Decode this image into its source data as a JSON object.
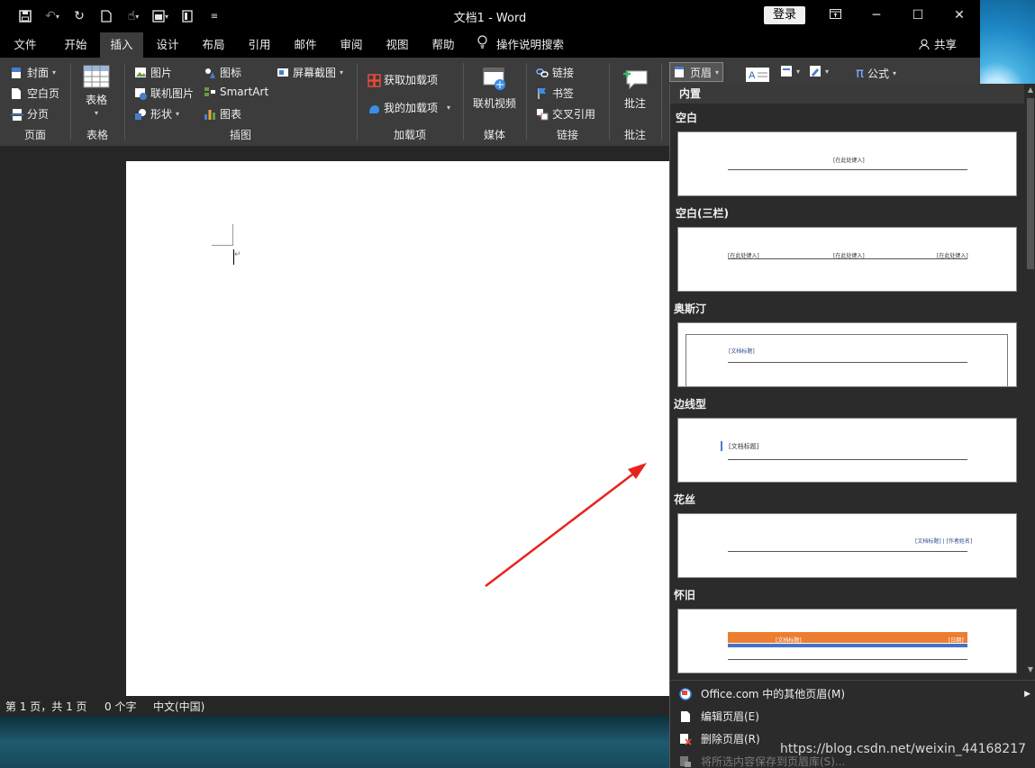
{
  "window": {
    "title": "文档1  -  Word",
    "login_label": "登录"
  },
  "menu": {
    "tabs": [
      "文件",
      "开始",
      "插入",
      "设计",
      "布局",
      "引用",
      "邮件",
      "审阅",
      "视图",
      "帮助"
    ],
    "active_tab": "插入",
    "tell_me": "操作说明搜索",
    "share": "共享"
  },
  "ribbon": {
    "pages": {
      "cover": "封面",
      "blank": "空白页",
      "break": "分页",
      "label": "页面"
    },
    "tables": {
      "table": "表格",
      "label": "表格"
    },
    "illustrations": {
      "pictures": "图片",
      "online_pictures": "联机图片",
      "shapes": "形状",
      "icons": "图标",
      "smartart": "SmartArt",
      "chart": "图表",
      "screenshot": "屏幕截图",
      "label": "插图"
    },
    "addins": {
      "get": "获取加载项",
      "mine": "我的加载项",
      "label": "加载项"
    },
    "media": {
      "video": "联机视频",
      "label": "媒体"
    },
    "links": {
      "link": "链接",
      "bookmark": "书签",
      "cross_ref": "交叉引用",
      "label": "链接"
    },
    "comments": {
      "comment": "批注",
      "label": "批注"
    },
    "header_footer": {
      "header": "页眉"
    },
    "symbols": {
      "equation": "公式"
    }
  },
  "status": {
    "page": "第 1 页，共 1 页",
    "words": "0 个字",
    "language": "中文(中国)"
  },
  "gallery": {
    "header": "内置",
    "sections": [
      {
        "name": "空白",
        "placeholders": [
          "[在此处键入]"
        ]
      },
      {
        "name": "空白(三栏)",
        "placeholders": [
          "[在此处键入]",
          "[在此处键入]",
          "[在此处键入]"
        ]
      },
      {
        "name": "奥斯汀",
        "placeholders": [
          "[文档标题]"
        ]
      },
      {
        "name": "边线型",
        "placeholders": [
          "[文档标题]"
        ]
      },
      {
        "name": "花丝",
        "placeholders": [
          "[文档标题] | [作者姓名]"
        ]
      },
      {
        "name": "怀旧",
        "placeholders": [
          "[文档标题]",
          "[日期]"
        ]
      }
    ],
    "menu": [
      {
        "label": "Office.com 中的其他页眉(M)",
        "enabled": true,
        "submenu": true
      },
      {
        "label": "编辑页眉(E)",
        "enabled": true,
        "submenu": false
      },
      {
        "label": "删除页眉(R)",
        "enabled": true,
        "submenu": false
      },
      {
        "label": "将所选内容保存到页眉库(S)...",
        "enabled": false,
        "submenu": false
      }
    ]
  },
  "watermark": "https://blog.csdn.net/weixin_44168217",
  "colors": {
    "titlebar": "#000000",
    "ribbon": "#3c3c3c",
    "page": "#ffffff",
    "annotation_arrow": "#e8231e",
    "retro_orange": "#ed7d31",
    "retro_blue": "#4472c4"
  }
}
